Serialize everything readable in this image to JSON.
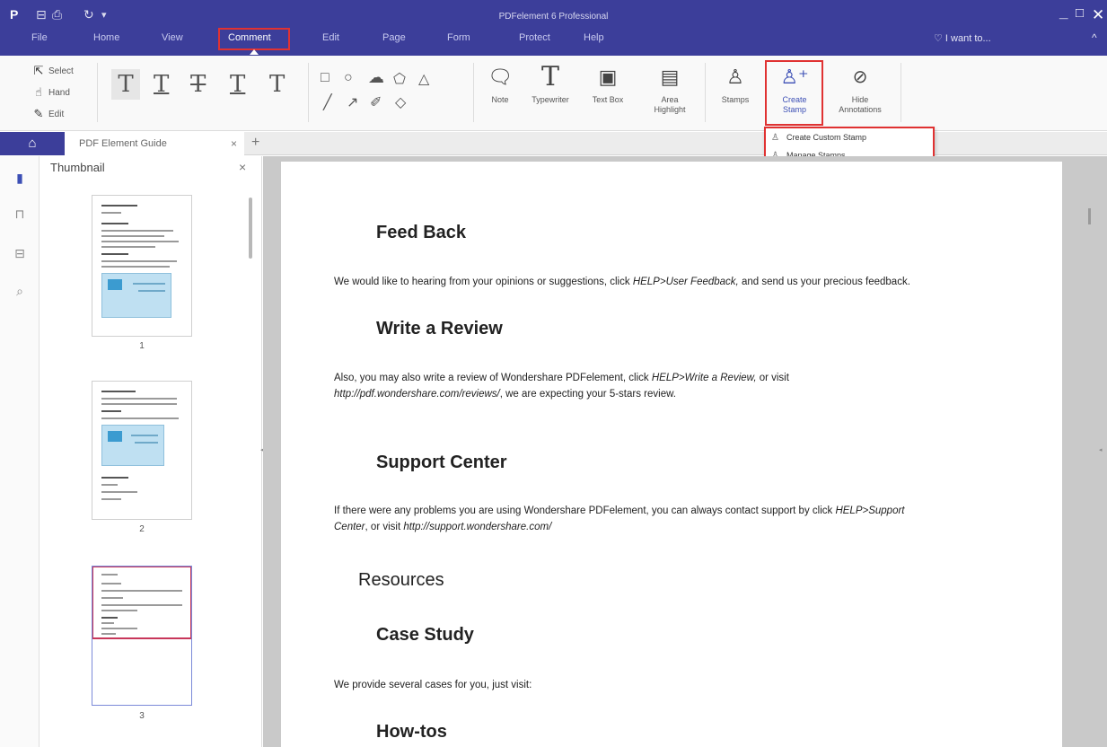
{
  "window": {
    "title": "PDFelement 6 Professional",
    "controls": {
      "minimize": "_",
      "maximize": "□",
      "close": "✕"
    }
  },
  "quick_access": {
    "logo_icon": "P",
    "save_icon": "⊟",
    "print_icon": "⎙",
    "redo_icon": "↻",
    "dropdown_icon": "▾"
  },
  "menu": {
    "items": [
      "File",
      "Home",
      "View",
      "Comment",
      "Edit",
      "Page",
      "Form",
      "Protect",
      "Help"
    ],
    "active": "Comment",
    "i_want_to": "I want to...",
    "collapse_icon": "^"
  },
  "ribbon": {
    "modes": {
      "select": "Select",
      "hand": "Hand",
      "edit": "Edit"
    },
    "text_tools": [
      "T",
      "T",
      "T",
      "T",
      "T"
    ],
    "buttons": {
      "note": "Note",
      "typewriter": "Typewriter",
      "text_box": "Text Box",
      "area_highlight_1": "Area",
      "area_highlight_2": "Highlight",
      "stamps": "Stamps",
      "create_stamp_1": "Create",
      "create_stamp_2": "Stamp",
      "hide_1": "Hide",
      "hide_2": "Annotations"
    }
  },
  "stamp_menu": {
    "items": [
      "Create Custom Stamp",
      "Manage Stamps"
    ]
  },
  "tabs": {
    "home_icon": "⌂",
    "document": "PDF Element Guide",
    "close": "×",
    "add": "+"
  },
  "thumbnail_pane": {
    "title": "Thumbnail",
    "close": "×",
    "pages": [
      "1",
      "2",
      "3"
    ],
    "selected_page": "3"
  },
  "document": {
    "feedback": {
      "heading": "Feed Back",
      "text_1": "We would like to hearing from your opinions or suggestions, click ",
      "link": "HELP>User Feedback,",
      "text_2": " and send us your precious feedback."
    },
    "review": {
      "heading": "Write a Review",
      "text_1": "Also,  you  may  also  write  a  review  of  Wondershare  PDFelement,  click  ",
      "link_1": "HELP>Write  a  Review,",
      "text_2": "  or  visit",
      "link_2": "http://pdf.wondershare.com/reviews/",
      "text_3": ", we are expecting your 5-stars review."
    },
    "support": {
      "heading": "Support Center",
      "text_1": "If there were any problems you are using Wondershare PDFelement, you can always contact support by click ",
      "link_1": "HELP>Support",
      "link_2": "Center",
      "text_2": ", or visit ",
      "link_3": "http://support.wondershare.com/"
    },
    "resources": "Resources",
    "case_study": {
      "heading": "Case Study",
      "text": "We provide several cases for you, just visit:"
    },
    "howtos": "How-tos"
  },
  "colors": {
    "titlebar": "#3c3e9a",
    "accent": "#3c4fb5",
    "highlight_border": "#e03232",
    "thumb_selected": "#c8375a"
  }
}
